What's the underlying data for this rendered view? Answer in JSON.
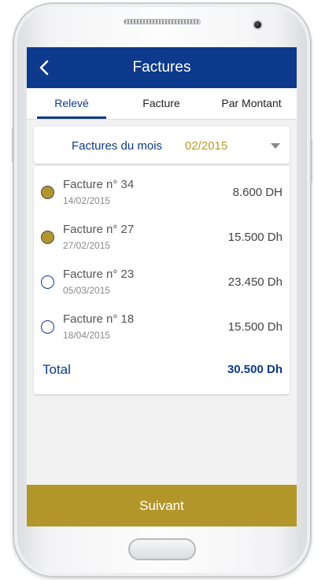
{
  "header": {
    "title": "Factures"
  },
  "tabs": [
    {
      "label": "Relevé",
      "active": true
    },
    {
      "label": "Facture",
      "active": false
    },
    {
      "label": "Par Montant",
      "active": false
    }
  ],
  "month_selector": {
    "label": "Factures du mois",
    "value": "02/2015"
  },
  "invoices": [
    {
      "title": "Facture n° 34",
      "date": "14/02/2015",
      "amount": "8.600 DH",
      "selected": true
    },
    {
      "title": "Facture n° 27",
      "date": "27/02/2015",
      "amount": "15.500 Dh",
      "selected": true
    },
    {
      "title": "Facture n° 23",
      "date": "05/03/2015",
      "amount": "23.450 Dh",
      "selected": false
    },
    {
      "title": "Facture n° 18",
      "date": "18/04/2015",
      "amount": "15.500 Dh",
      "selected": false
    }
  ],
  "total": {
    "label": "Total",
    "amount": "30.500 Dh"
  },
  "footer": {
    "next_label": "Suivant"
  },
  "colors": {
    "primary": "#0d3a8c",
    "accent_gold": "#b3962a",
    "background": "#f2f2f2"
  }
}
